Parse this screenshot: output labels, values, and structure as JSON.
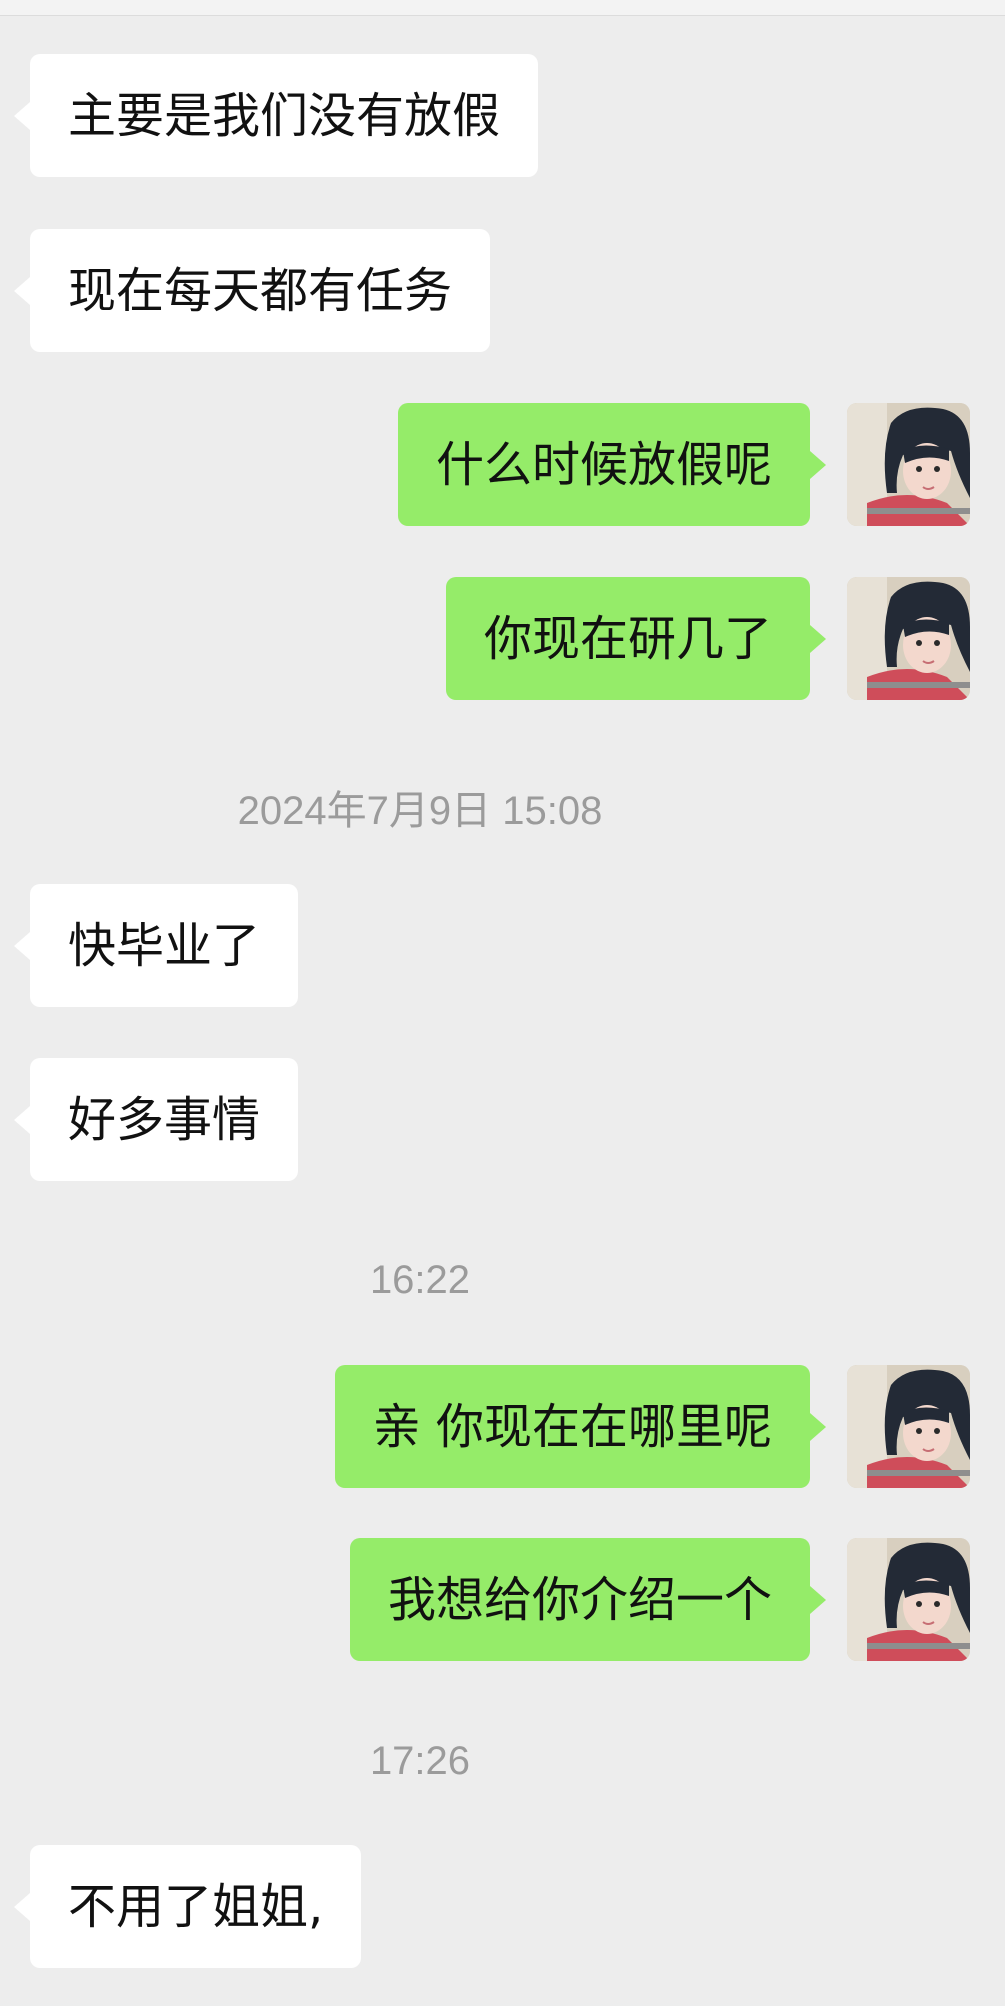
{
  "messages": [
    {
      "side": "in",
      "text": "主要是我们没有放假"
    },
    {
      "side": "in",
      "text": "现在每天都有任务"
    },
    {
      "side": "out",
      "text": "什么时候放假呢"
    },
    {
      "side": "out",
      "text": "你现在研几了"
    },
    {
      "timestamp": "2024年7月9日 15:08"
    },
    {
      "side": "in",
      "text": "快毕业了"
    },
    {
      "side": "in",
      "text": "好多事情"
    },
    {
      "timestamp": "16:22"
    },
    {
      "side": "out",
      "text": "亲 你现在在哪里呢"
    },
    {
      "side": "out",
      "text": "我想给你介绍一个"
    },
    {
      "timestamp": "17:26"
    },
    {
      "side": "in",
      "text": "不用了姐姐,"
    }
  ],
  "colors": {
    "background": "#ededed",
    "incoming_bubble": "#ffffff",
    "outgoing_bubble": "#95ec69",
    "timestamp_text": "#9b9b9b"
  },
  "icons": {
    "avatar": "user-avatar-photo"
  }
}
